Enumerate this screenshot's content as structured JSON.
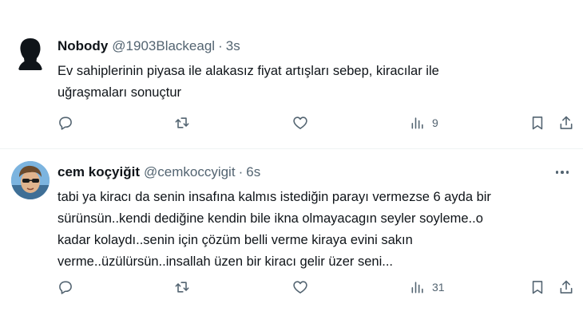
{
  "tweets": [
    {
      "name": "Nobody",
      "handle": "@1903Blackeagl",
      "dot": "·",
      "time": "3s",
      "text": "Ev sahiplerinin piyasa ile alakasız fiyat artışları sebep, kiracılar ile\nuğraşmaları sonuçtur",
      "views": "9",
      "avatar_icon": "silhouette-avatar"
    },
    {
      "name": "cem koçyiğit",
      "handle": "@cemkoccyigit",
      "dot": "·",
      "time": "6s",
      "text": "tabi ya kiracı da senin insafına kalmıs istediğin parayı vermezse 6 ayda bir\nsürünsün..kendi dediğine kendin bile ikna olmayacagın seyler soyleme..o\nkadar kolaydı..senin için çözüm belli verme kiraya evini sakın\nverme..üzülürsün..insallah üzen bir kiracı gelir üzer seni...",
      "views": "31",
      "avatar_icon": "photo-avatar"
    }
  ],
  "icons": {
    "reply": "reply-icon",
    "retweet": "retweet-icon",
    "like": "heart-icon",
    "views": "views-icon",
    "bookmark": "bookmark-icon",
    "share": "share-icon",
    "more": "more-icon"
  }
}
